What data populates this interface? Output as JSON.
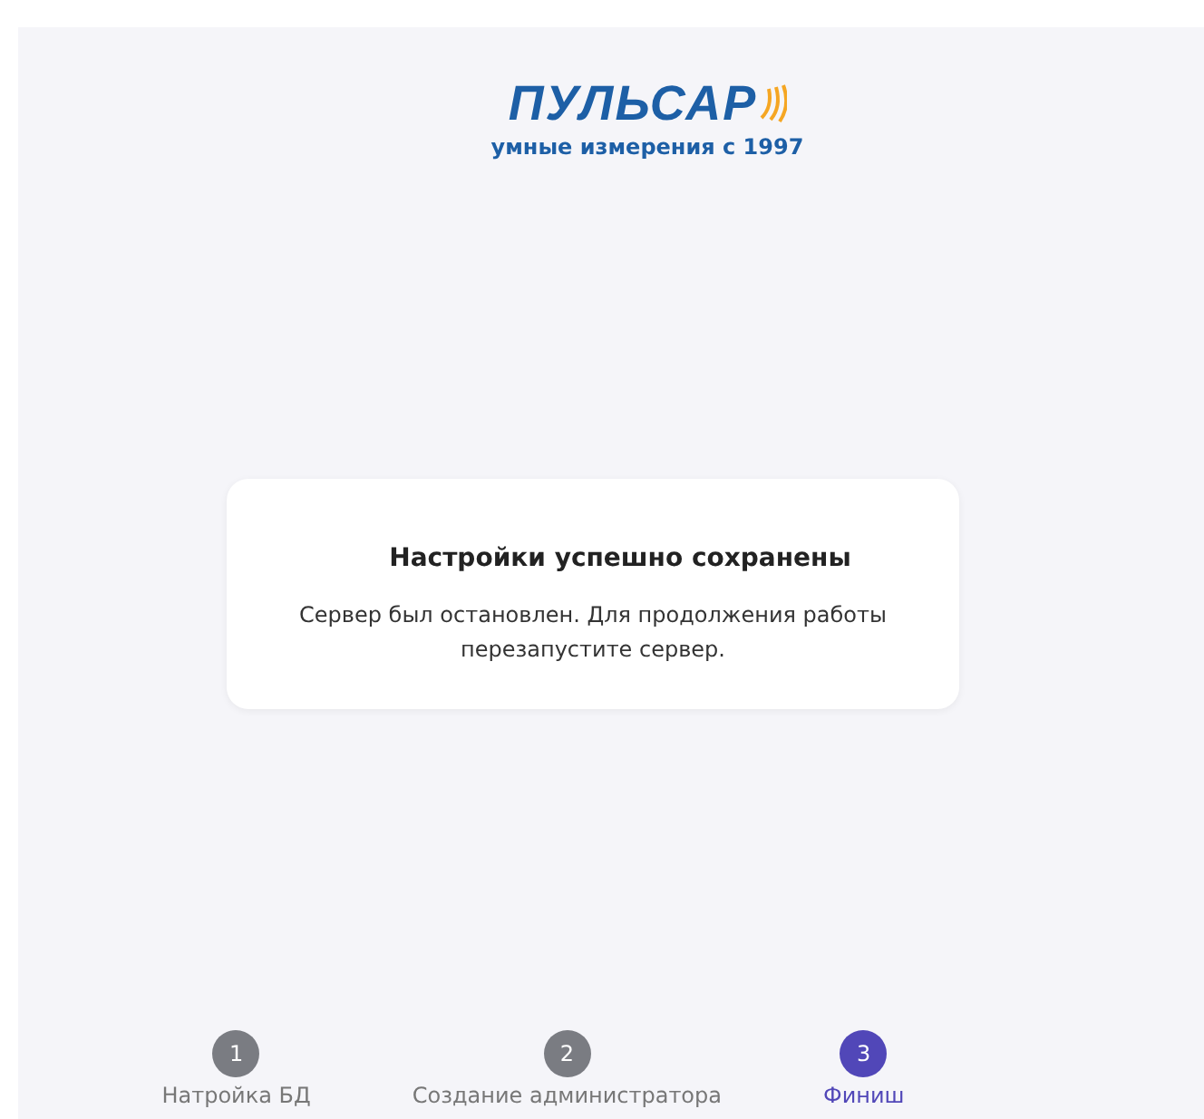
{
  "logo": {
    "brand": "ПУЛЬСАР",
    "tagline": "умные измерения с 1997"
  },
  "card": {
    "title": "Настройки успешно сохранены",
    "message": "Сервер был остановлен. Для продолжения работы перезапустите сервер."
  },
  "steps": [
    {
      "number": "1",
      "label": "Натройка БД",
      "selected": false
    },
    {
      "number": "2",
      "label": "Создание администратора",
      "selected": false
    },
    {
      "number": "3",
      "label": "Финиш",
      "selected": true
    }
  ]
}
